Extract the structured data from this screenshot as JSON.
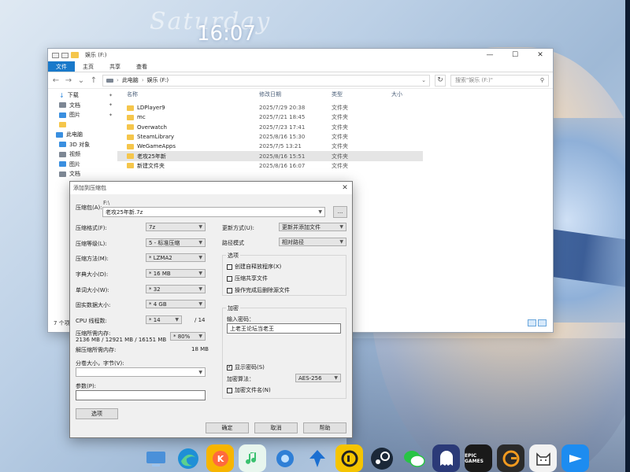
{
  "desktop": {
    "clock": "16:07",
    "wallpaper_text": "Saturday"
  },
  "explorer": {
    "title": "娱乐 (F:)",
    "window_controls": [
      "—",
      "☐",
      "✕"
    ],
    "ribbon_tabs": [
      "文件",
      "主页",
      "共享",
      "查看"
    ],
    "address": {
      "root": "此电脑",
      "current": "娱乐 (F:)"
    },
    "search_placeholder": "搜索\"娱乐 (F:)\"",
    "nav_items": [
      {
        "label": "下载",
        "pinned": true
      },
      {
        "label": "文档",
        "pinned": true
      },
      {
        "label": "图片",
        "pinned": true
      },
      {
        "label": ""
      },
      {
        "label": "此电脑"
      },
      {
        "label": "3D 对象"
      },
      {
        "label": "视频"
      },
      {
        "label": "图片"
      },
      {
        "label": "文档"
      }
    ],
    "columns": [
      "名称",
      "修改日期",
      "类型",
      "大小"
    ],
    "files": [
      {
        "name": "LDPlayer9",
        "date": "2025/7/29 20:38",
        "type": "文件夹"
      },
      {
        "name": "mc",
        "date": "2025/7/21 18:45",
        "type": "文件夹"
      },
      {
        "name": "Overwatch",
        "date": "2025/7/23 17:41",
        "type": "文件夹"
      },
      {
        "name": "SteamLibrary",
        "date": "2025/8/16 15:30",
        "type": "文件夹"
      },
      {
        "name": "WeGameApps",
        "date": "2025/7/5 13:21",
        "type": "文件夹"
      },
      {
        "name": "老攻25年新",
        "date": "2025/8/16 15:51",
        "type": "文件夹"
      },
      {
        "name": "新建文件夹",
        "date": "2025/8/16 16:07",
        "type": "文件夹"
      }
    ],
    "status": "7 个项目"
  },
  "dialog": {
    "title": "添加到压缩包",
    "archive_label": "压缩包(A):",
    "archive_path_hint": "F:\\",
    "archive_name": "老攻25年新.7z",
    "browse_button": "...",
    "format_label": "压缩格式(F):",
    "format_value": "7z",
    "level_label": "压缩等级(L):",
    "level_value": "5 - 标准压缩",
    "method_label": "压缩方法(M):",
    "method_value": "* LZMA2",
    "dict_label": "字典大小(D):",
    "dict_value": "* 16 MB",
    "word_label": "单词大小(W):",
    "word_value": "* 32",
    "solid_label": "固实数据大小:",
    "solid_value": "* 4 GB",
    "threads_label": "CPU 线程数:",
    "threads_value": "* 14",
    "threads_total": "/ 14",
    "mem_comp_label": "压缩所需内存:",
    "mem_comp_value": "2136 MB / 12921 MB / 16151 MB",
    "mem_percent": "* 80%",
    "mem_decomp_label": "解压缩所需内存:",
    "mem_decomp_value": "18 MB",
    "split_label": "分卷大小，字节(V):",
    "params_label": "参数(P):",
    "options_button": "选项",
    "update_label": "更新方式(U):",
    "update_value": "更新并添加文件",
    "path_label": "路径模式",
    "path_value": "相对路径",
    "options_group": "选项",
    "opt_sfx": "创建自释放程序(X)",
    "opt_shared": "压缩共享文件",
    "opt_delete": "操作完成后删除源文件",
    "encrypt_group": "加密",
    "password_label": "输入密码：",
    "password_value": "上老王论坛当老王",
    "show_password": "显示密码(S)",
    "encrypt_method_label": "加密算法：",
    "encrypt_method_value": "AES-256",
    "encrypt_names": "加密文件名(N)",
    "ok": "确定",
    "cancel": "取消",
    "help": "帮助"
  },
  "dock_apps": [
    {
      "name": "此电脑",
      "color": "#4a90d9"
    },
    {
      "name": "Edge",
      "color": "#1f8fd6"
    },
    {
      "name": "酷狗",
      "color": "#f7b500"
    },
    {
      "name": "音乐",
      "color": "#3ac16f"
    },
    {
      "name": "设置",
      "color": "#2f7fd6"
    },
    {
      "name": "下载",
      "color": "#1b6fd1"
    },
    {
      "name": "雷电",
      "color": "#f5c400"
    },
    {
      "name": "Steam",
      "color": "#1b2838"
    },
    {
      "name": "微信",
      "color": "#28c445"
    },
    {
      "name": "幽灵",
      "color": "#2b3a78"
    },
    {
      "name": "EPIC GAMES",
      "color": "#1a1a1a"
    },
    {
      "name": "G",
      "color": "#2a2a2a"
    },
    {
      "name": "猫",
      "color": "#f2f2f2"
    },
    {
      "name": "飞",
      "color": "#1d8cf0"
    }
  ]
}
